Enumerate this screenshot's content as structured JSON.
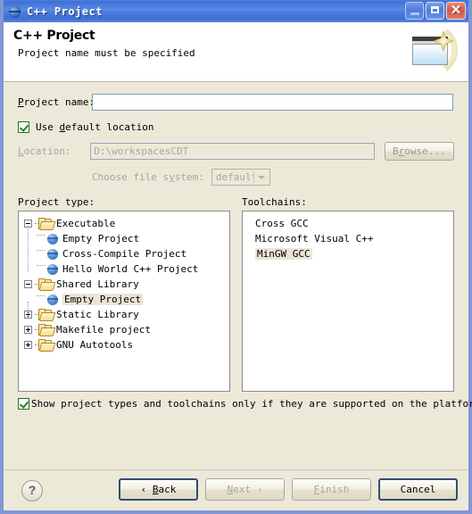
{
  "window": {
    "title": "C++ Project",
    "icon": "globe-icon",
    "minimize_label": "",
    "maximize_label": "",
    "close_label": "✕"
  },
  "header": {
    "title": "C++ Project",
    "description": "Project name must be specified",
    "banner_icon": "wizard-window-sparkle-icon"
  },
  "form": {
    "project_name_label": "Project name:",
    "project_name_value": "",
    "use_default_location_label": "Use default location",
    "use_default_location_checked": true,
    "location_label": "Location:",
    "location_value": "D:\\workspacesCDT",
    "browse_label": "Browse...",
    "choose_file_system_label": "Choose file system:",
    "file_system_value": "default",
    "file_system_options": [
      "default"
    ]
  },
  "project_type": {
    "label": "Project type:",
    "nodes": [
      {
        "label": "Executable",
        "kind": "folder",
        "level": 0,
        "expanded": true,
        "selected": false
      },
      {
        "label": "Empty Project",
        "kind": "leaf",
        "level": 1,
        "selected": false
      },
      {
        "label": "Cross-Compile Project",
        "kind": "leaf",
        "level": 1,
        "selected": false
      },
      {
        "label": "Hello World C++ Project",
        "kind": "leaf",
        "level": 1,
        "selected": false
      },
      {
        "label": "Shared Library",
        "kind": "folder",
        "level": 0,
        "expanded": true,
        "selected": false
      },
      {
        "label": "Empty Project",
        "kind": "leaf",
        "level": 1,
        "selected": true
      },
      {
        "label": "Static Library",
        "kind": "folder",
        "level": 0,
        "expanded": false,
        "selected": false
      },
      {
        "label": "Makefile project",
        "kind": "folder",
        "level": 0,
        "expanded": false,
        "selected": false
      },
      {
        "label": "GNU Autotools",
        "kind": "folder",
        "level": 0,
        "expanded": false,
        "selected": false
      }
    ]
  },
  "toolchains": {
    "label": "Toolchains:",
    "items": [
      {
        "label": "Cross GCC",
        "selected": false
      },
      {
        "label": "Microsoft Visual C++",
        "selected": false
      },
      {
        "label": "MinGW GCC",
        "selected": true
      }
    ]
  },
  "show_supported": {
    "label": "Show project types and toolchains only if they are supported on the platform",
    "checked": true
  },
  "footer": {
    "help_label": "?",
    "back_label": "‹ Back",
    "next_label": "Next ›",
    "finish_label": "Finish",
    "cancel_label": "Cancel",
    "back_enabled": true,
    "next_enabled": false,
    "finish_enabled": false,
    "cancel_enabled": true
  },
  "colors": {
    "titlebar": "#4b7edf",
    "dialog_bg": "#ece9d8",
    "selection": "#ece9d8",
    "close_button": "#d0584a"
  }
}
